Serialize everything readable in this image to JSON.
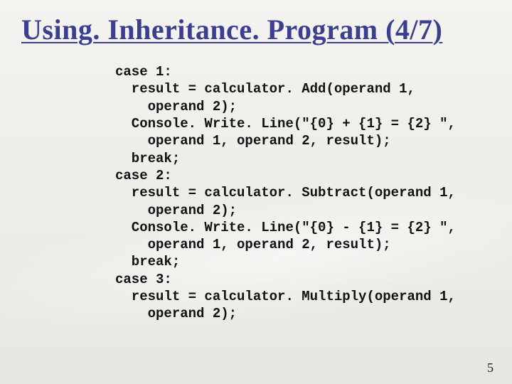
{
  "slide": {
    "title": "Using. Inheritance. Program (4/7)",
    "page_number": "5",
    "code_lines": [
      "case 1:",
      "  result = calculator. Add(operand 1,",
      "    operand 2);",
      "  Console. Write. Line(\"{0} + {1} = {2} \",",
      "    operand 1, operand 2, result);",
      "  break;",
      "case 2:",
      "  result = calculator. Subtract(operand 1,",
      "    operand 2);",
      "  Console. Write. Line(\"{0} - {1} = {2} \",",
      "    operand 1, operand 2, result);",
      "  break;",
      "case 3:",
      "  result = calculator. Multiply(operand 1,",
      "    operand 2);"
    ]
  }
}
